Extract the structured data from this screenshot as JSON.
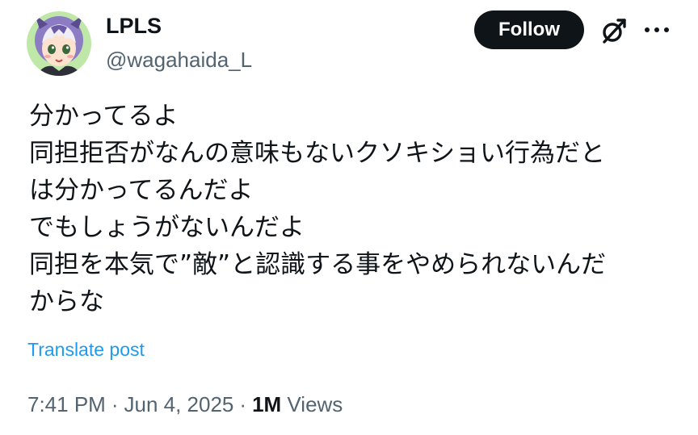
{
  "author": {
    "display_name": "LPLS",
    "handle": "@wagahaida_L",
    "avatar_icon": "anime-character-avatar"
  },
  "actions": {
    "follow_label": "Follow",
    "grok_icon": "grok-icon",
    "more_icon": "more-icon"
  },
  "tweet": {
    "lines": [
      "分かってるよ",
      "同担拒否がなんの意味もないクソキショい行為だと",
      "は分かってるんだよ",
      "でもしょうがないんだよ",
      "同担を本気で”敵”と認識する事をやめられないんだ",
      "からな"
    ],
    "translate_label": "Translate post"
  },
  "meta": {
    "time": "7:41 PM",
    "date": "Jun 4, 2025",
    "separator": "·",
    "views_count": "1M",
    "views_label": "Views"
  },
  "colors": {
    "text": "#0f1419",
    "secondary": "#536471",
    "link": "#1d9bf0",
    "button_bg": "#0f1419"
  }
}
